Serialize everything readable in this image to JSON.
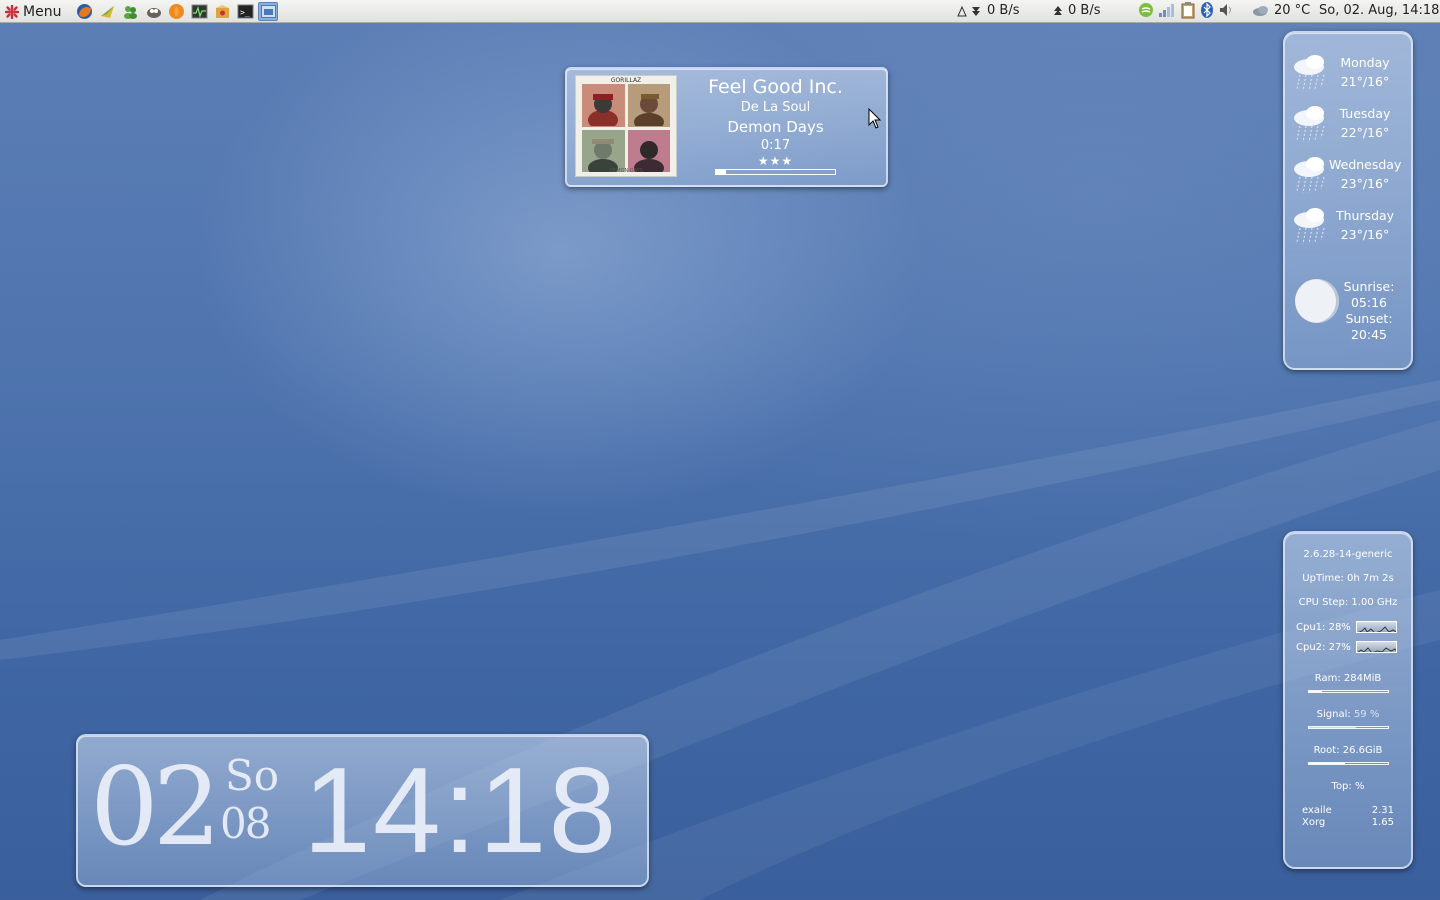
{
  "panel": {
    "menu_label": "Menu",
    "launchers": [
      "firefox-icon",
      "mail-icon",
      "messenger-icon",
      "gimp-icon",
      "media-player-icon",
      "system-monitor-icon",
      "package-icon",
      "terminal-icon",
      "desktop-icon"
    ],
    "net_down": "0 B/s",
    "net_up": "0 B/s",
    "tray_icons": [
      "music-tray-icon",
      "wifi-signal-icon",
      "clipboard-icon",
      "bluetooth-icon",
      "volume-icon"
    ],
    "temperature": "20 °C",
    "datetime": "So, 02. Aug, 14:18"
  },
  "music": {
    "title": "Feel Good Inc.",
    "artist": "De La Soul",
    "album": "Demon Days",
    "time": "0:17",
    "rating": "★★★",
    "cover_band": "GORILLAZ",
    "cover_subtitle": "DEMON DAYS",
    "progress": 0.08
  },
  "weather": {
    "days": [
      {
        "name": "Monday",
        "temps": "21°/16°",
        "icon": "rain-cloud-icon"
      },
      {
        "name": "Tuesday",
        "temps": "22°/16°",
        "icon": "rain-cloud-icon"
      },
      {
        "name": "Wednesday",
        "temps": "23°/16°",
        "icon": "rain-cloud-icon"
      },
      {
        "name": "Thursday",
        "temps": "23°/16°",
        "icon": "rain-cloud-icon"
      }
    ],
    "sunrise_label": "Sunrise:",
    "sunrise": "05:16",
    "sunset_label": "Sunset:",
    "sunset": "20:45"
  },
  "sysmon": {
    "kernel": "2.6.28-14-generic",
    "uptime": "UpTime: 0h 7m 2s",
    "cpu_step": "CPU Step: 1.00 GHz",
    "cpu1": "Cpu1:  28%",
    "cpu2": "Cpu2:  27%",
    "ram": "Ram: 284MiB",
    "ram_fraction": 0.17,
    "signal_label": "Signal:",
    "signal_value": "59  %",
    "signal_fraction": 0.59,
    "root": "Root: 26.6GiB",
    "root_fraction": 0.45,
    "top": "Top: %",
    "processes": [
      {
        "name": "exaile",
        "value": "2.31"
      },
      {
        "name": "Xorg",
        "value": "1.65"
      }
    ]
  },
  "clock": {
    "day": "02",
    "weekday": "So",
    "month": "08",
    "time": "14:18"
  }
}
